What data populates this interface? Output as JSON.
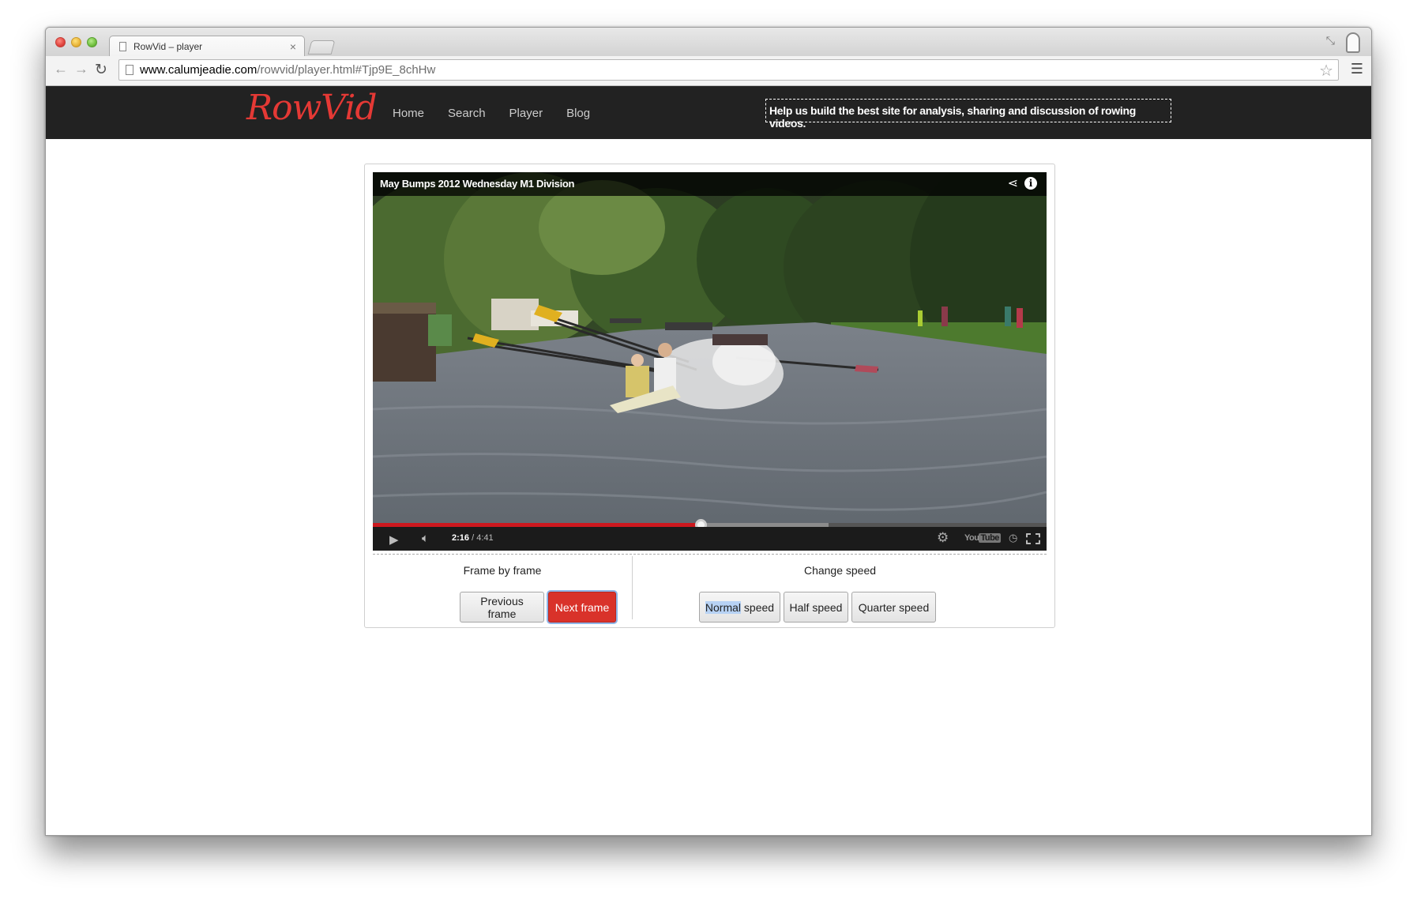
{
  "browser": {
    "tab_title": "RowVid – player",
    "tab_close": "×",
    "url_host": "www.calumjeadie.com",
    "url_path": "/rowvid/player.html#Tjp9E_8chHw",
    "icons": {
      "back": "back-arrow-icon",
      "forward": "forward-arrow-icon",
      "reload": "reload-icon",
      "star": "bookmark-star-icon",
      "menu": "hamburger-menu-icon"
    }
  },
  "site": {
    "logo": "RowVid",
    "nav": [
      "Home",
      "Search",
      "Player",
      "Blog"
    ],
    "banner": "Help us build the best site for analysis, sharing and discussion of rowing videos.",
    "brand_color": "#e53935",
    "header_bg": "#222222"
  },
  "player": {
    "title": "May Bumps 2012 Wednesday M1 Division",
    "current_time": "2:16",
    "duration": "/ 4:41",
    "played_fraction": 0.487,
    "loaded_fraction": 0.676,
    "youtube_you": "You",
    "youtube_tube": "Tube"
  },
  "controls": {
    "frame_title": "Frame by frame",
    "previous_frame": "Previous frame",
    "next_frame": "Next frame",
    "speed_title": "Change speed",
    "normal_highlight": "Normal",
    "normal_rest": " speed",
    "half_speed": "Half speed",
    "quarter_speed": "Quarter speed"
  }
}
